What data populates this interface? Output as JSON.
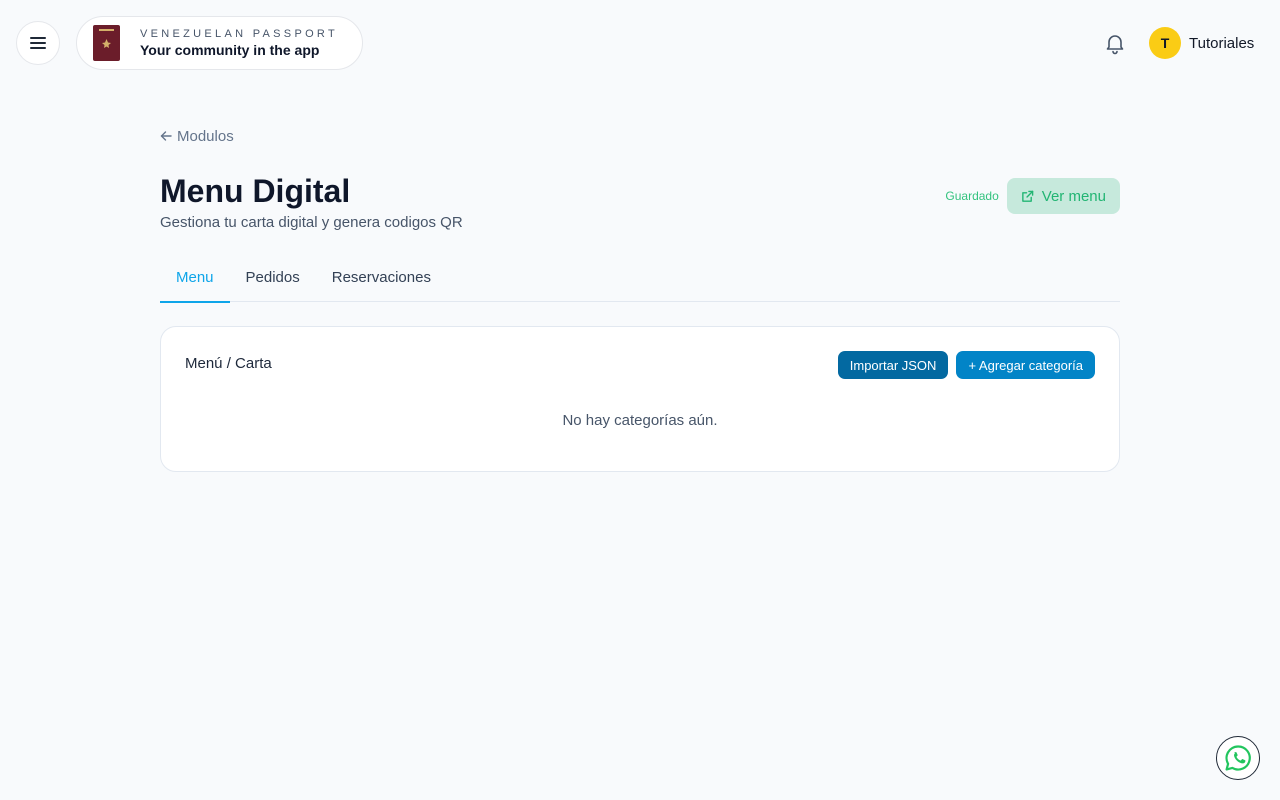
{
  "header": {
    "brand_eyebrow": "VENEZUELAN PASSPORT",
    "brand_tagline": "Your community in the app",
    "user_initial": "T",
    "user_name": "Tutoriales"
  },
  "page": {
    "back_label": "Modulos",
    "title": "Menu Digital",
    "subtitle": "Gestiona tu carta digital y genera codigos QR",
    "saved_status": "Guardado",
    "view_menu_label": "Ver menu"
  },
  "tabs": [
    {
      "label": "Menu",
      "active": true
    },
    {
      "label": "Pedidos",
      "active": false
    },
    {
      "label": "Reservaciones",
      "active": false
    }
  ],
  "card": {
    "title": "Menú / Carta",
    "import_label": "Importar JSON",
    "add_label": "+ Agregar categoría",
    "empty_message": "No hay categorías aún."
  },
  "colors": {
    "accent": "#0ea5e9",
    "saved_green": "#34c37f",
    "avatar_yellow": "#facc15",
    "passport_maroon": "#6b1d2a"
  },
  "icons": {
    "menu": "hamburger-menu-icon",
    "bell": "bell-icon",
    "back": "arrow-left-icon",
    "external": "external-link-icon",
    "whatsapp": "whatsapp-icon"
  }
}
